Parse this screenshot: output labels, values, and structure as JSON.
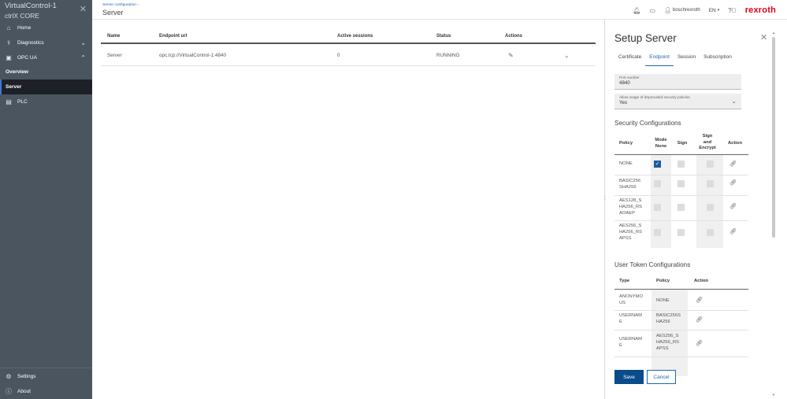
{
  "sidebar": {
    "title_line1": "VirtualControl-1",
    "title_line2": "ctrlX CORE",
    "items": [
      {
        "label": "Home",
        "icon": "home-icon"
      },
      {
        "label": "Diagnostics",
        "icon": "diagnostics-icon"
      },
      {
        "label": "OPC UA",
        "icon": "opcua-icon"
      },
      {
        "label": "Overview"
      },
      {
        "label": "Server"
      },
      {
        "label": "PLC",
        "icon": "plc-icon"
      },
      {
        "label": "Settings",
        "icon": "gear-icon"
      },
      {
        "label": "About",
        "icon": "info-icon"
      }
    ]
  },
  "topbar": {
    "breadcrumb": "Server configuration ›",
    "title": "Server",
    "user": "boschrexroth",
    "lang": "EN",
    "logo": "rexroth"
  },
  "table": {
    "headers": [
      "Name",
      "Endpoint url",
      "Active sessions",
      "Status",
      "Actions"
    ],
    "rows": [
      {
        "name": "Server",
        "url": "opc.tcp://VirtualControl-1:4840",
        "sessions": "0",
        "status": "RUNNING"
      }
    ]
  },
  "panel": {
    "title": "Setup Server",
    "tabs": [
      "Certificate",
      "Endpoint",
      "Session",
      "Subscription"
    ],
    "active_tab": "Endpoint",
    "port": {
      "label": "Port number",
      "value": "4840"
    },
    "deprecated": {
      "label": "Allow usage of deprecated security policies",
      "value": "Yes"
    },
    "security_title": "Security Configurations",
    "security_headers": {
      "policy": "Policy",
      "mode_none_1": "Mode",
      "mode_none_2": "None",
      "sign": "Sign",
      "sae_1": "Sign",
      "sae_2": "and",
      "sae_3": "Encrypt",
      "action": "Action"
    },
    "security_rows": [
      {
        "l1": "NONE",
        "l2": "",
        "l3": "",
        "mode_none": true
      },
      {
        "l1": "BASIC256",
        "l2": "SHA256",
        "l3": "",
        "mode_none": false
      },
      {
        "l1": "AES128_S",
        "l2": "HA256_RS",
        "l3": "AOAEP",
        "mode_none": false
      },
      {
        "l1": "AES256_S",
        "l2": "HA256_RS",
        "l3": "APSS",
        "mode_none": false
      }
    ],
    "token_title": "User Token Configurations",
    "token_headers": {
      "type": "Type",
      "policy": "Policy",
      "action": "Action"
    },
    "token_rows": [
      {
        "t1": "ANONYMO",
        "t2": "US",
        "p1": "NONE",
        "p2": "",
        "p3": ""
      },
      {
        "t1": "USERNAM",
        "t2": "E",
        "p1": "BASIC256S",
        "p2": "HA256",
        "p3": ""
      },
      {
        "t1": "USERNAM",
        "t2": "E",
        "p1": "AES256_S",
        "p2": "HA256_RS",
        "p3": "APSS"
      }
    ],
    "save_label": "Save",
    "cancel_label": "Cancel"
  },
  "colors": {
    "sidebar_bg": "#4a5560",
    "active_item_bg": "#1d2127",
    "accent": "#1f66b5",
    "primary_button": "#0a4b8a",
    "brand": "#e2001a"
  }
}
